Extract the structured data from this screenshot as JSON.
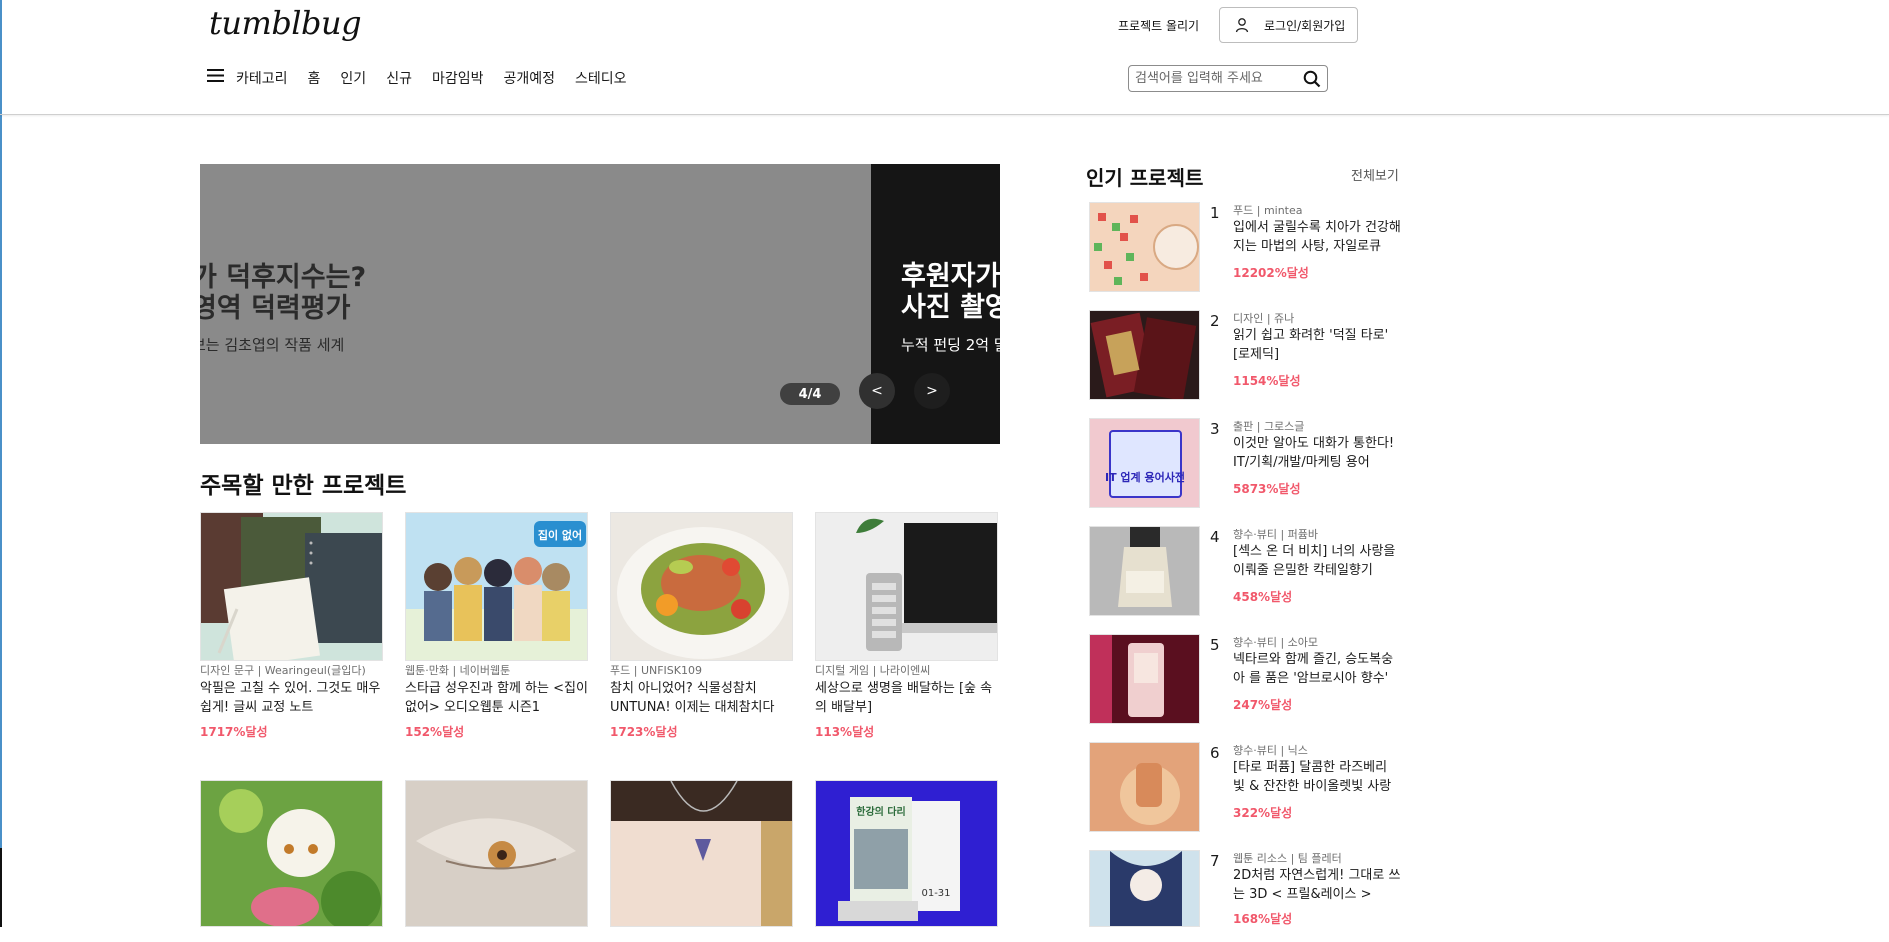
{
  "header": {
    "logo": "tumblbug",
    "upload_label": "프로젝트 올리기",
    "login_label": "로그인/회원가입",
    "nav": [
      "카테고리",
      "홈",
      "인기",
      "신규",
      "마감임박",
      "공개예정",
      "스테디오"
    ],
    "search_placeholder": "검색어를 입력해 주세요"
  },
  "banner": {
    "slide_a_line1": "가 덕후지수는?",
    "slide_a_line2": "영역 덕력평가",
    "slide_a_sub": "보는 김초엽의 작품 세계",
    "slide_b_line1": "후원자가",
    "slide_b_line2": "사진 촬영",
    "slide_b_sub": "누적 펀딩 2억 달",
    "pager": "4/4",
    "prev": "<",
    "next": ">"
  },
  "section": {
    "title": "주목할 만한 프로젝트",
    "cards": [
      {
        "cat": "디자인 문구 | Wearingeul(글입다)",
        "title": "악필은 고칠 수 있어. 그것도 매우 쉽게! 글씨 교정 노트",
        "rate": "1717%달성"
      },
      {
        "cat": "웹툰·만화 | 네이버웹툰",
        "title": "스타급 성우진과 함께 하는 <집이 없어> 오디오웹툰 시즌1",
        "rate": "152%달성"
      },
      {
        "cat": "푸드 | UNFISK109",
        "title": "참치 아니었어? 식물성참치 UNTUNA! 이제는 대체참치다",
        "rate": "1723%달성"
      },
      {
        "cat": "디지털 게임 | 나라이엔씨",
        "title": "세상으로 생명을 배달하는 [숲 속의 배달부]",
        "rate": "113%달성"
      }
    ]
  },
  "popular": {
    "title": "인기 프로젝트",
    "view_all": "전체보기",
    "items": [
      {
        "rank": "1",
        "cat": "푸드 | mintea",
        "title": "입에서 굴릴수록 치아가 건강해지는 마법의 사탕, 자일로큐",
        "rate": "12202%달성"
      },
      {
        "rank": "2",
        "cat": "디자인 | 쥬나",
        "title": "읽기 쉽고 화려한 '덕질 타로' [로제딕]",
        "rate": "1154%달성"
      },
      {
        "rank": "3",
        "cat": "출판 | 그로스글",
        "title": "이것만 알아도 대화가 통한다! IT/기획/개발/마케팅 용어",
        "rate": "5873%달성"
      },
      {
        "rank": "4",
        "cat": "향수·뷰티 | 퍼퓸바",
        "title": "[섹스 온 더 비치] 너의 사랑을 이뤄줄 은밀한 칵테일향기",
        "rate": "458%달성"
      },
      {
        "rank": "5",
        "cat": "향수·뷰티 | 소아모",
        "title": "넥타르와 함께 즐긴, 승도복숭아 를 품은 '암브로시아 향수'",
        "rate": "247%달성"
      },
      {
        "rank": "6",
        "cat": "향수·뷰티 | 닉스",
        "title": "[타로 퍼퓸] 달콤한 라즈베리 빛 & 잔잔한 바이올렛빛 사랑",
        "rate": "322%달성"
      },
      {
        "rank": "7",
        "cat": "웹툰 리소스 | 팀 플레터",
        "title": "2D처럼 자연스럽게! 그대로 쓰는 3D < 프릴&레이스 >",
        "rate": "168%달성"
      }
    ],
    "thumb3_text": "IT 업계 용어사전"
  },
  "thumb_text": {
    "card2_badge": "집이 없어",
    "card8_title": "한강의 다리",
    "card8_label": "01-31"
  },
  "colors": {
    "accent": "#f1586b",
    "banner_grey": "#8a8a8a",
    "banner_dark": "#151515"
  }
}
